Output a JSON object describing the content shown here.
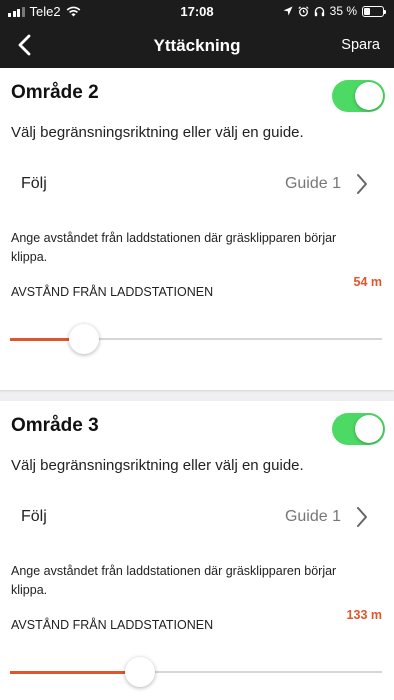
{
  "status_bar": {
    "carrier": "Tele2",
    "time": "17:08",
    "battery": "35 %",
    "battery_level": 0.35
  },
  "nav": {
    "title": "Yttäckning",
    "save_label": "Spara"
  },
  "areas": [
    {
      "title": "Område 2",
      "enabled": true,
      "description": "Välj begränsningsriktning eller välj en guide.",
      "follow_label": "Följ",
      "follow_value": "Guide 1",
      "distance_description": "Ange avståndet från laddstationen där gräsklipparen börjar klippa.",
      "distance_label": "AVSTÅND FRÅN LADDSTATIONEN",
      "distance_value": "54 m",
      "slider_fraction": 0.14
    },
    {
      "title": "Område 3",
      "enabled": true,
      "description": "Välj begränsningsriktning eller välj en guide.",
      "follow_label": "Följ",
      "follow_value": "Guide 1",
      "distance_description": "Ange avståndet från laddstationen där gräsklipparen börjar klippa.",
      "distance_label": "AVSTÅND FRÅN LADDSTATIONEN",
      "distance_value": "133 m",
      "slider_fraction": 0.29
    }
  ],
  "colors": {
    "accent": "#e0562c",
    "toggle_on": "#4cd964",
    "bar": "#1c1c1c"
  }
}
